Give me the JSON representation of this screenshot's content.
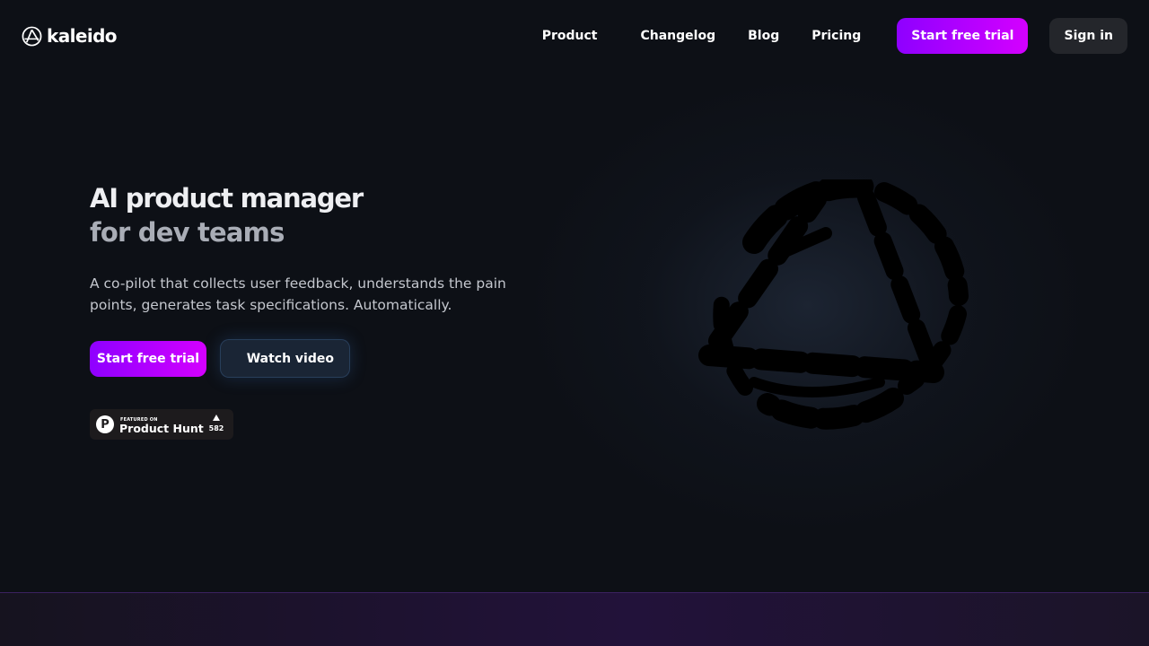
{
  "brand": {
    "name": "kaleido",
    "icon": "kaleido-logo-icon"
  },
  "nav": {
    "product": "Product",
    "changelog": "Changelog",
    "blog": "Blog",
    "pricing": "Pricing",
    "trial": "Start free trial",
    "signin": "Sign in"
  },
  "hero": {
    "title": "AI product manager",
    "subtitle": "for dev teams",
    "description": "A co-pilot that collects user feedback, understands the pain points, generates task specifications. Automatically.",
    "trial_button": "Start free trial",
    "video_button": "Watch video",
    "art_icon": "kaleido-triangle-circle-icon"
  },
  "product_hunt": {
    "featured": "FEATURED ON",
    "name": "Product Hunt",
    "logo_letter": "P",
    "upvotes": "582"
  },
  "colors": {
    "background": "#0d1016",
    "accent_start": "#8e00ff",
    "accent_end": "#d400ff",
    "signin_bg": "#24262b"
  }
}
